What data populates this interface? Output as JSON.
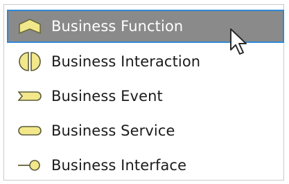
{
  "list": {
    "items": [
      {
        "label": "Business Function",
        "icon": "business-function-icon",
        "selected": true
      },
      {
        "label": "Business Interaction",
        "icon": "business-interaction-icon",
        "selected": false
      },
      {
        "label": "Business Event",
        "icon": "business-event-icon",
        "selected": false
      },
      {
        "label": "Business Service",
        "icon": "business-service-icon",
        "selected": false
      },
      {
        "label": "Business Interface",
        "icon": "business-interface-icon",
        "selected": false
      }
    ]
  },
  "colors": {
    "selection_background": "#8a8a8a",
    "selection_border": "#2f88d6",
    "icon_fill": "#f2e78b",
    "icon_stroke": "#5b5b3a"
  }
}
